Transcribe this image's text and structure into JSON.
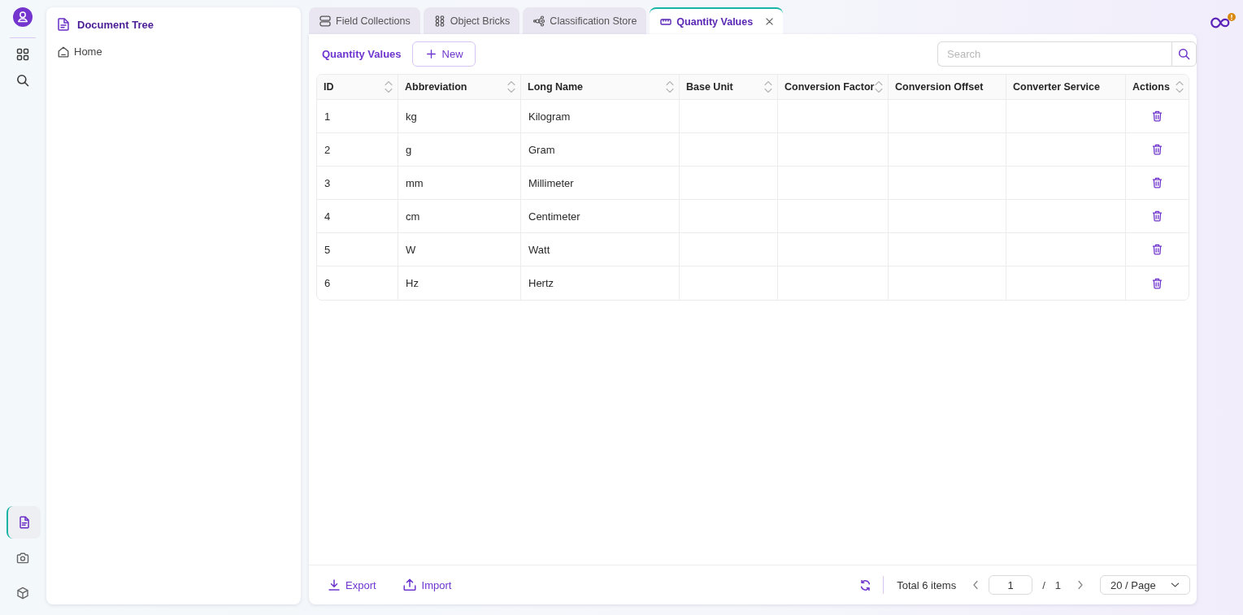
{
  "rail": {
    "top_items": [
      {
        "selected": false
      },
      {
        "selected": false
      }
    ],
    "bottom_items": [
      {
        "selected": true
      },
      {
        "selected": false
      },
      {
        "selected": false
      }
    ]
  },
  "sidebar": {
    "title": "Document Tree",
    "items": [
      {
        "label": "Home"
      }
    ]
  },
  "tabs": [
    {
      "label": "Field Collections",
      "selected": false,
      "closable": false
    },
    {
      "label": "Object Bricks",
      "selected": false,
      "closable": false
    },
    {
      "label": "Classification Store",
      "selected": false,
      "closable": false
    },
    {
      "label": "Quantity Values",
      "selected": true,
      "closable": true
    }
  ],
  "toolbar": {
    "title": "Quantity Values",
    "new_button": "New",
    "search": {
      "placeholder": "Search"
    }
  },
  "table": {
    "columns": [
      {
        "label": "ID",
        "sortable": true
      },
      {
        "label": "Abbreviation",
        "sortable": true
      },
      {
        "label": "Long Name",
        "sortable": true
      },
      {
        "label": "Base Unit",
        "sortable": true
      },
      {
        "label": "Conversion Factor",
        "sortable": true
      },
      {
        "label": "Conversion Offset",
        "sortable": false
      },
      {
        "label": "Converter Service",
        "sortable": false
      },
      {
        "label": "Actions",
        "sortable": true
      }
    ],
    "rows": [
      {
        "cells": [
          "1",
          "kg",
          "Kilogram"
        ]
      },
      {
        "cells": [
          "2",
          "g",
          "Gram"
        ]
      },
      {
        "cells": [
          "3",
          "mm",
          "Millimeter"
        ]
      },
      {
        "cells": [
          "4",
          "cm",
          "Centimeter"
        ]
      },
      {
        "cells": [
          "5",
          "W",
          "Watt"
        ]
      },
      {
        "cells": [
          "6",
          "Hz",
          "Hertz"
        ]
      }
    ]
  },
  "footer": {
    "export": "Export",
    "import": "Import",
    "total": "Total 6 items",
    "page": "1",
    "separator": "/",
    "page_count": "1",
    "page_size": "20 / Page"
  }
}
